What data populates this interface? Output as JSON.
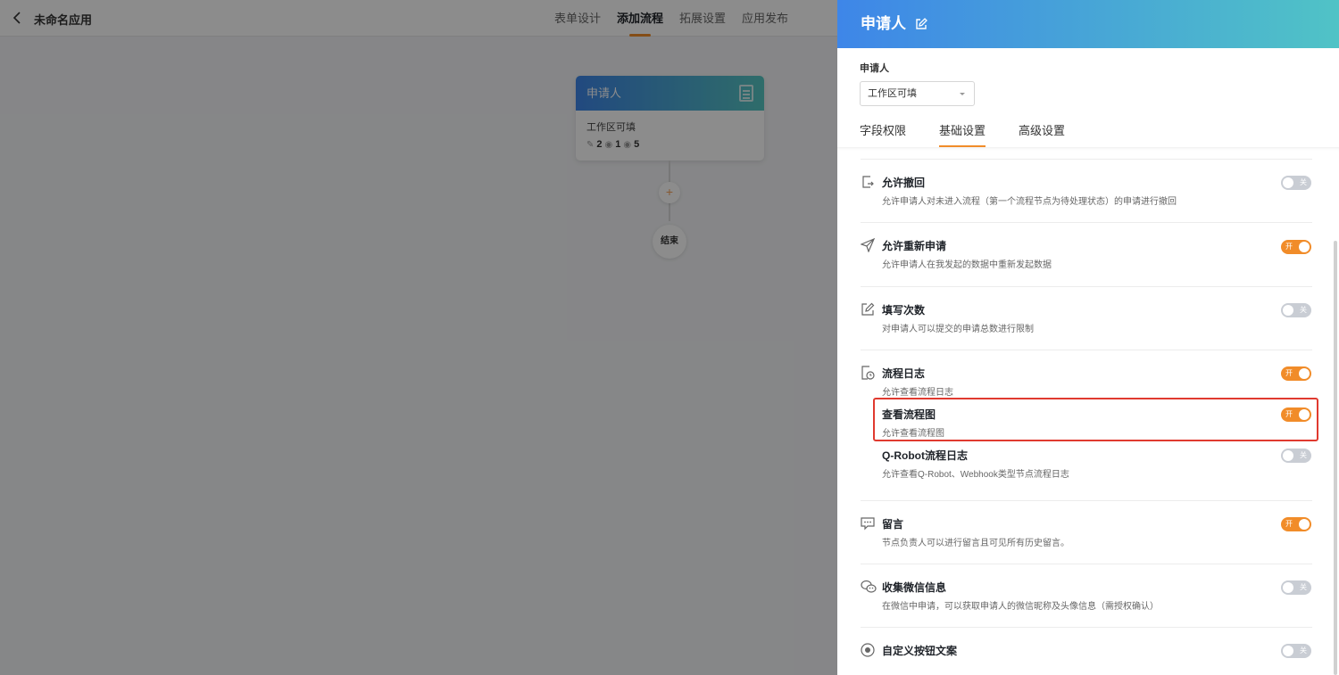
{
  "header": {
    "app_name": "未命名应用",
    "tabs": [
      {
        "label": "表单设计",
        "active": false
      },
      {
        "label": "添加流程",
        "active": true
      },
      {
        "label": "拓展设置",
        "active": false
      },
      {
        "label": "应用发布",
        "active": false
      }
    ]
  },
  "canvas": {
    "node": {
      "title": "申请人",
      "subtitle": "工作区可填",
      "stat1": "2",
      "stat2": "1",
      "stat3": "5"
    },
    "add_symbol": "+",
    "end_label": "结束"
  },
  "drawer": {
    "title": "申请人",
    "field_label": "申请人",
    "select_value": "工作区可填",
    "tabs": [
      {
        "label": "字段权限",
        "active": false
      },
      {
        "label": "基础设置",
        "active": true
      },
      {
        "label": "高级设置",
        "active": false
      }
    ],
    "toggle_on_label": "开",
    "toggle_off_label": "关",
    "settings": [
      {
        "icon": "withdraw-icon",
        "title": "允许撤回",
        "desc": "允许申请人对未进入流程（第一个流程节点为待处理状态）的申请进行撤回",
        "on": false
      },
      {
        "icon": "send-icon",
        "title": "允许重新申请",
        "desc": "允许申请人在我发起的数据中重新发起数据",
        "on": true
      },
      {
        "icon": "edit-icon",
        "title": "填写次数",
        "desc": "对申请人可以提交的申请总数进行限制",
        "on": false
      },
      {
        "icon": "log-icon",
        "title": "流程日志",
        "desc": "允许查看流程日志",
        "on": true
      },
      {
        "icon": "",
        "title": "查看流程图",
        "desc": "允许查看流程图",
        "on": true
      },
      {
        "icon": "",
        "title": "Q-Robot流程日志",
        "desc": "允许查看Q-Robot、Webhook类型节点流程日志",
        "on": false
      },
      {
        "icon": "comment-icon",
        "title": "留言",
        "desc": "节点负责人可以进行留言且可见所有历史留言。",
        "on": true
      },
      {
        "icon": "wechat-icon",
        "title": "收集微信信息",
        "desc": "在微信中申请，可以获取申请人的微信昵称及头像信息（需授权确认）",
        "on": false
      },
      {
        "icon": "radio-icon",
        "title": "自定义按钮文案",
        "desc": "",
        "on": false
      }
    ]
  }
}
